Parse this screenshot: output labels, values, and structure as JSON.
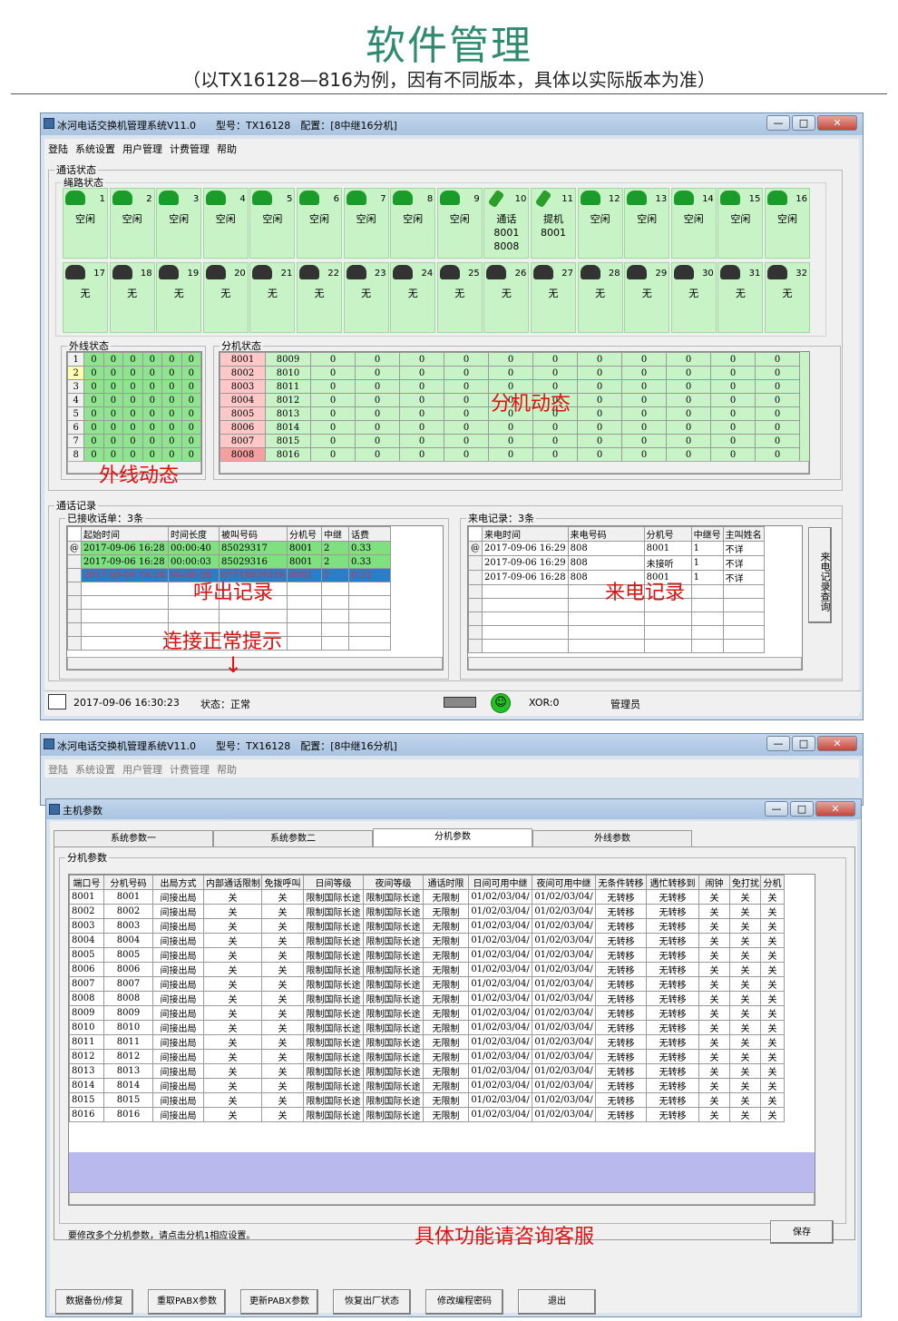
{
  "header": {
    "title": "软件管理",
    "subtitle": "（以TX16128—816为例，因有不同版本，具体以实际版本为准）"
  },
  "main_window": {
    "title": "冰河电话交换机管理系统V11.0　　型号：TX16128　配置：[8中继16分机]",
    "menu": [
      "登陆",
      "系统设置",
      "用户管理",
      "计费管理",
      "帮助"
    ],
    "call_status_label": "通话状态",
    "line_status_label": "绳路状态",
    "lines_top": [
      {
        "n": "1",
        "s": "空闲",
        "k": "idle"
      },
      {
        "n": "2",
        "s": "空闲",
        "k": "idle"
      },
      {
        "n": "3",
        "s": "空闲",
        "k": "idle"
      },
      {
        "n": "4",
        "s": "空闲",
        "k": "idle"
      },
      {
        "n": "5",
        "s": "空闲",
        "k": "idle"
      },
      {
        "n": "6",
        "s": "空闲",
        "k": "idle"
      },
      {
        "n": "7",
        "s": "空闲",
        "k": "idle"
      },
      {
        "n": "8",
        "s": "空闲",
        "k": "idle"
      },
      {
        "n": "9",
        "s": "空闲",
        "k": "idle"
      },
      {
        "n": "10",
        "s": "通话\n8001\n8008",
        "k": "off"
      },
      {
        "n": "11",
        "s": "提机\n8001",
        "k": "off"
      },
      {
        "n": "12",
        "s": "空闲",
        "k": "idle"
      },
      {
        "n": "13",
        "s": "空闲",
        "k": "idle"
      },
      {
        "n": "14",
        "s": "空闲",
        "k": "idle"
      },
      {
        "n": "15",
        "s": "空闲",
        "k": "idle"
      },
      {
        "n": "16",
        "s": "空闲",
        "k": "idle"
      }
    ],
    "lines_bottom": [
      "17",
      "18",
      "19",
      "20",
      "21",
      "22",
      "23",
      "24",
      "25",
      "26",
      "27",
      "28",
      "29",
      "30",
      "31",
      "32"
    ],
    "lines_bottom_status": "无",
    "trunk_label": "外线状态",
    "trunk_rows": [
      [
        "1",
        "0",
        "0",
        "0",
        "0",
        "0",
        "0"
      ],
      [
        "2",
        "0",
        "0",
        "0",
        "0",
        "0",
        "0"
      ],
      [
        "3",
        "0",
        "0",
        "0",
        "0",
        "0",
        "0"
      ],
      [
        "4",
        "0",
        "0",
        "0",
        "0",
        "0",
        "0"
      ],
      [
        "5",
        "0",
        "0",
        "0",
        "0",
        "0",
        "0"
      ],
      [
        "6",
        "0",
        "0",
        "0",
        "0",
        "0",
        "0"
      ],
      [
        "7",
        "0",
        "0",
        "0",
        "0",
        "0",
        "0"
      ],
      [
        "8",
        "0",
        "0",
        "0",
        "0",
        "0",
        "0"
      ]
    ],
    "ext_label": "分机状态",
    "ext_rows": [
      [
        "8001",
        "8009"
      ],
      [
        "8002",
        "8010"
      ],
      [
        "8003",
        "8011"
      ],
      [
        "8004",
        "8012"
      ],
      [
        "8005",
        "8013"
      ],
      [
        "8006",
        "8014"
      ],
      [
        "8007",
        "8015"
      ],
      [
        "8008",
        "8016"
      ]
    ],
    "ext_zero": "0",
    "annot_trunk": "外线动态",
    "annot_ext": "分机动态",
    "records_label": "通话记录",
    "out_label": "已接收话单：3条",
    "out_headers": [
      "起始时间",
      "时间长度",
      "被叫号码",
      "分机号",
      "中继",
      "话费"
    ],
    "out_rows": [
      [
        "2017-09-06 16:28",
        "00:00:40",
        "85029317",
        "8001",
        "2",
        "0.33"
      ],
      [
        "2017-09-06 16:28",
        "00:00:03",
        "85029316",
        "8001",
        "2",
        "0.33"
      ],
      [
        "2017-09-06 16:28",
        "00:00:28",
        "07718029316",
        "8001",
        "2",
        "0.22"
      ]
    ],
    "in_label": "来电记录：3条",
    "in_headers": [
      "来电时间",
      "来电号码",
      "分机号",
      "中继号",
      "主叫姓名"
    ],
    "in_rows": [
      [
        "2017-09-06 16:29",
        "808",
        "8001",
        "1",
        "不详"
      ],
      [
        "2017-09-06 16:29",
        "808",
        "未接听",
        "1",
        "不详"
      ],
      [
        "2017-09-06 16:28",
        "808",
        "8001",
        "1",
        "不详"
      ]
    ],
    "in_query_btn": "来电记录查询",
    "annot_out": "呼出记录",
    "annot_in": "来电记录",
    "annot_conn": "连接正常提示",
    "status": {
      "time": "2017-09-06 16:30:23",
      "state": "状态：正常",
      "xor": "XOR:0",
      "user": "管理员"
    }
  },
  "param_window": {
    "bg_title": "冰河电话交换机管理系统V11.0　　型号：TX16128　配置：[8中继16分机]",
    "title": "主机参数",
    "tabs": [
      "系统参数一",
      "系统参数二",
      "分机参数",
      "外线参数"
    ],
    "group": "分机参数",
    "headers": [
      "端口号",
      "分机号码",
      "出局方式",
      "内部通话限制",
      "免拨呼叫",
      "日间等级",
      "夜间等级",
      "通话时限",
      "日间可用中继",
      "夜间可用中继",
      "无条件转移",
      "遇忙转移到",
      "闹钟",
      "免打扰",
      "分机"
    ],
    "row_values": [
      "间接出局",
      "关",
      "关",
      "限制国际长途",
      "限制国际长途",
      "无限制",
      "01/02/03/04/",
      "01/02/03/04/",
      "无转移",
      "无转移",
      "关",
      "关",
      "关"
    ],
    "ports": [
      "8001",
      "8002",
      "8003",
      "8004",
      "8005",
      "8006",
      "8007",
      "8008",
      "8009",
      "8010",
      "8011",
      "8012",
      "8013",
      "8014",
      "8015",
      "8016"
    ],
    "hint": "要修改多个分机参数，请点击分机1相应设置。",
    "annot": "具体功能请咨询客服",
    "save": "保存",
    "buttons": [
      "数据备份/修复",
      "重取PABX参数",
      "更新PABX参数",
      "恢复出厂状态",
      "修改编程密码",
      "退出"
    ]
  }
}
